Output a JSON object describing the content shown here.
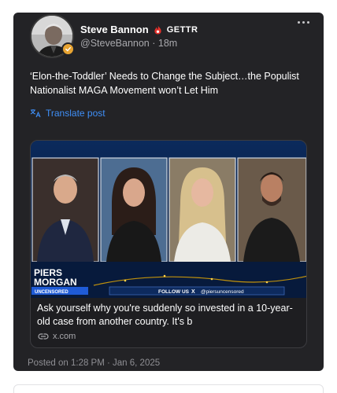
{
  "author": {
    "name": "Steve Bannon",
    "platform": "GETTR",
    "handle": "@SteveBannon",
    "time_ago": "18m"
  },
  "post": {
    "text": "‘Elon-the-Toddler’ Needs to Change the Subject…the Populist Nationalist MAGA Movement won’t Let Him",
    "translate_label": "Translate post"
  },
  "link_preview": {
    "show_logo_line1": "PIERS",
    "show_logo_line2": "MORGAN",
    "show_logo_tag": "UNCENSORED",
    "ticker_follow": "FOLLOW US",
    "ticker_handle": "@piersuncensored",
    "title": "Ask yourself why you're suddenly so invested in a 10-year-old case from another country. It's b",
    "domain": "x.com"
  },
  "timestamp": "Posted on 1:28 PM · Jan 6, 2025",
  "colors": {
    "card_bg": "#232326",
    "link_blue": "#3f8ff7",
    "gettr_red": "#e4312b",
    "badge_gold": "#e8a432"
  },
  "icons": {
    "more": "more-horizontal-icon",
    "translate": "translate-icon",
    "link": "link-icon",
    "platform": "gettr-flame-icon",
    "verified": "verified-badge-icon"
  }
}
